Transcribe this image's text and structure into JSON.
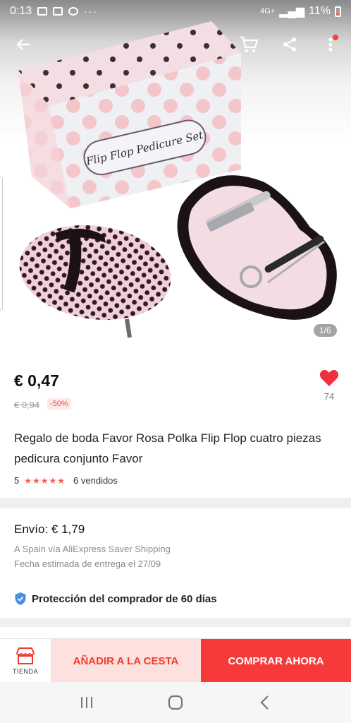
{
  "status_bar": {
    "time": "0:13",
    "battery": "11%",
    "network": "4G+"
  },
  "gallery": {
    "counter": "1/6",
    "box_label": "Flip Flop Pedicure Set"
  },
  "product": {
    "price": "€ 0,47",
    "original_price": "€ 0,94",
    "discount": "-50%",
    "wishlist_count": "74",
    "title": "Regalo de boda Favor Rosa Polka Flip Flop cuatro piezas pedicura conjunto Favor",
    "rating": "5",
    "sold": "6 vendidos"
  },
  "shipping": {
    "label": "Envío: € 1,79",
    "route": "A Spain vía AliExpress Saver Shipping",
    "estimate": "Fecha estimada de entrega el 27/09"
  },
  "protection": {
    "text": "Protección del comprador de 60 días"
  },
  "actions": {
    "store": "TIENDA",
    "add_to_cart": "AÑADIR A LA CESTA",
    "buy_now": "COMPRAR AHORA"
  },
  "icons": {
    "back": "back-arrow-icon",
    "cart": "cart-icon",
    "share": "share-icon",
    "more": "more-icon",
    "wishlist": "heart-icon",
    "shield": "shield-icon",
    "store": "store-icon"
  },
  "colors": {
    "accent": "#f63a3a",
    "accent_light": "#fde1de",
    "heart": "#f1303d",
    "star": "#ff5a4e"
  }
}
